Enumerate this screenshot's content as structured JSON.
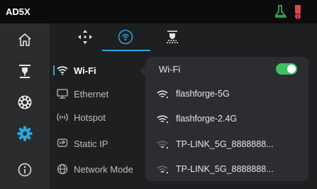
{
  "app": {
    "title": "AD5X"
  },
  "status_icons": [
    "printer-status-icon",
    "filament-status-icon"
  ],
  "sidebar": {
    "items": [
      {
        "icon": "home-icon"
      },
      {
        "icon": "print-head-icon"
      },
      {
        "icon": "filament-spool-icon"
      },
      {
        "icon": "settings-gear-icon"
      },
      {
        "icon": "info-icon"
      }
    ]
  },
  "tabs": [
    {
      "icon": "move-axes-icon"
    },
    {
      "icon": "network-icon",
      "active": true
    },
    {
      "icon": "print-head-settings-icon"
    }
  ],
  "network_menu": {
    "items": [
      {
        "label": "Wi-Fi",
        "icon": "wifi-icon",
        "active": true
      },
      {
        "label": "Ethernet",
        "icon": "ethernet-icon"
      },
      {
        "label": "Hotspot",
        "icon": "hotspot-icon"
      },
      {
        "label": "Static IP",
        "icon": "static-ip-icon"
      },
      {
        "label": "Network Mode",
        "icon": "globe-icon"
      }
    ]
  },
  "wifi_panel": {
    "header": "Wi-Fi",
    "enabled": true,
    "networks": [
      {
        "ssid": "flashforge-5G",
        "signal": "strong"
      },
      {
        "ssid": "flashforge-2.4G",
        "signal": "strong"
      },
      {
        "ssid": "TP-LINK_5G_8888888...",
        "signal": "weak"
      },
      {
        "ssid": "TP-LINK_5G_8888888...",
        "signal": "weak"
      }
    ]
  },
  "colors": {
    "accent": "#2aa6e0",
    "toggle_on": "#3fbf5b",
    "status_green": "#3fbf5b",
    "status_red": "#e0454b"
  }
}
